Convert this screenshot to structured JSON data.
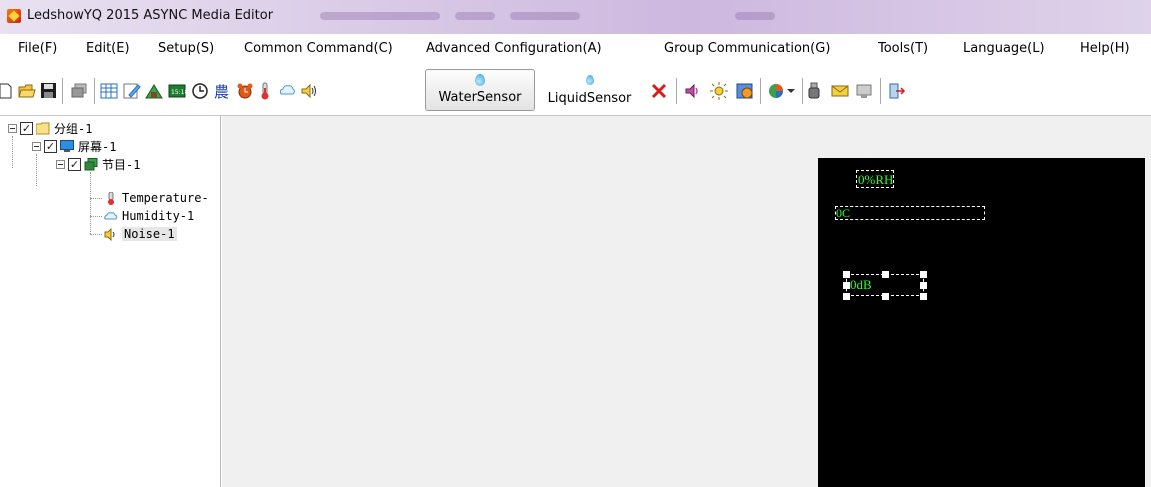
{
  "window": {
    "title": "LedshowYQ 2015 ASYNC Media Editor"
  },
  "menu": [
    {
      "label": "File(F)"
    },
    {
      "label": "Edit(E)"
    },
    {
      "label": "Setup(S)"
    },
    {
      "label": "Common Command(C)"
    },
    {
      "label": "Advanced Configuration(A)"
    },
    {
      "label": "Group Communication(G)"
    },
    {
      "label": "Tools(T)"
    },
    {
      "label": "Language(L)"
    },
    {
      "label": "Help(H)"
    }
  ],
  "toolbar": {
    "water_sensor_label": "WaterSensor",
    "liquid_sensor_label": "LiquidSensor",
    "icons": [
      "new-file-icon",
      "open-folder-icon",
      "save-icon",
      "copy-window-icon",
      "grid-icon",
      "edit-icon",
      "image-icon",
      "clock-digital-icon",
      "clock-icon",
      "lunar-calendar-icon",
      "alarm-icon",
      "thermometer-icon",
      "humidity-icon",
      "sound-icon",
      "delete-icon",
      "speaker-icon",
      "brightness-icon",
      "timer-icon",
      "chart-icon",
      "usb-icon",
      "send-icon",
      "screen-icon",
      "exit-icon"
    ]
  },
  "tree": {
    "group": "分组-1",
    "screen": "屏幕-1",
    "program": "节目-1",
    "items": [
      {
        "label": "Temperature-",
        "icon": "thermometer-icon"
      },
      {
        "label": "Humidity-1",
        "icon": "humidity-icon"
      },
      {
        "label": "Noise-1",
        "icon": "sound-icon"
      }
    ]
  },
  "led": {
    "humidity_text": "0%RH",
    "temperature_text": "0C",
    "noise_text": "0dB"
  },
  "colors": {
    "led_text": "#2aff2a",
    "led_background": "#000000",
    "workspace": "#f0f0f0"
  }
}
